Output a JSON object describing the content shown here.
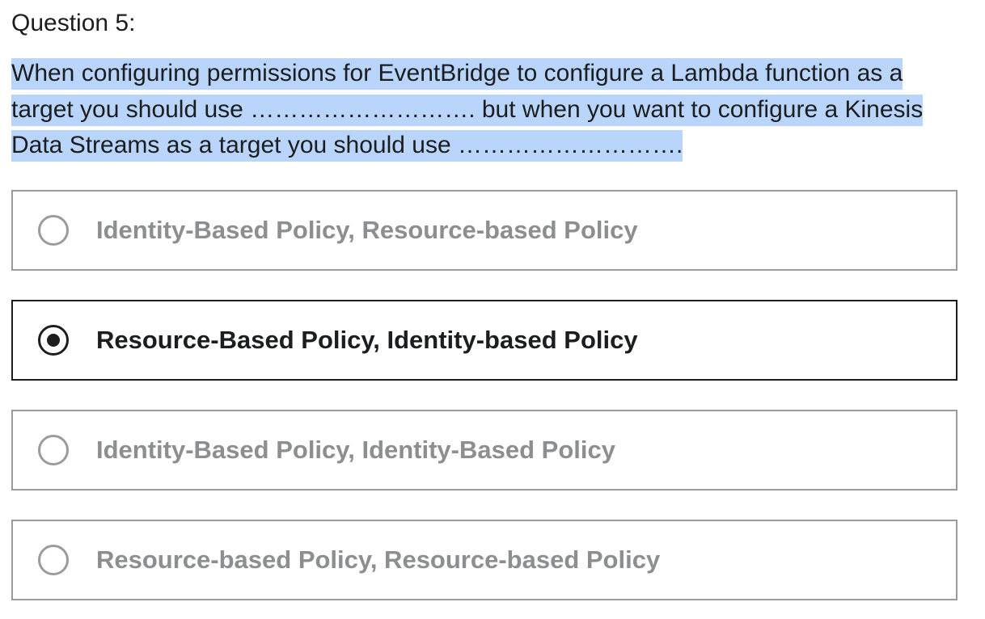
{
  "question": {
    "number_label": "Question 5:",
    "text": "When configuring permissions for EventBridge to configure a Lambda function as a target you should use ………………………. but when you want to configure a Kinesis Data Streams as a target you should use ………………………."
  },
  "options": [
    {
      "label": "Identity-Based Policy, Resource-based Policy",
      "selected": false
    },
    {
      "label": "Resource-Based Policy, Identity-based Policy",
      "selected": true
    },
    {
      "label": "Identity-Based Policy, Identity-Based Policy",
      "selected": false
    },
    {
      "label": "Resource-based Policy, Resource-based Policy",
      "selected": false
    }
  ],
  "colors": {
    "text": "#1c1d1f",
    "muted_text": "#8d8e8f",
    "border": "#9a9b9c",
    "selection_highlight": "#b9d5fb"
  }
}
